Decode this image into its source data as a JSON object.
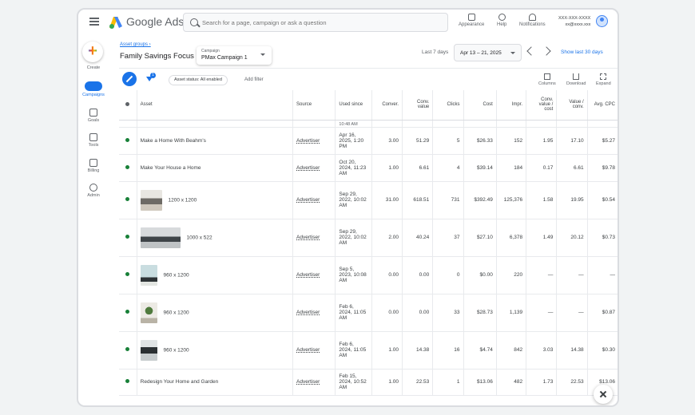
{
  "topbar": {
    "brand": "Google Ads",
    "search_placeholder": "Search for a page, campaign or ask a question",
    "appearance": "Appearance",
    "help": "Help",
    "notifications": "Notifications",
    "account_id": "XXX-XXX-XXXX",
    "account_email": "xx@xxxx.xxx"
  },
  "nav": {
    "create": "Create",
    "campaigns": "Campaigns",
    "goals": "Goals",
    "tools": "Tools",
    "billing": "Billing",
    "admin": "Admin"
  },
  "header": {
    "breadcrumb": "Asset groups ›",
    "title": "Family Savings Focus",
    "campaign_label": "Campaign",
    "campaign_value": "PMax Campaign 1",
    "date_label": "Last 7 days",
    "date_range": "Apr 13 – 21, 2025",
    "show_last": "Show last 30 days"
  },
  "toolbar": {
    "filter_count": "1",
    "status_chip": "Asset status: All enabled",
    "add_filter": "Add filter",
    "columns": "Columns",
    "download": "Download",
    "expand": "Expand"
  },
  "table": {
    "headers": {
      "asset": "Asset",
      "source": "Source",
      "used_since": "Used since",
      "conversions": "Conver.",
      "conv_value": "Conv. value",
      "clicks": "Clicks",
      "cost": "Cost",
      "impr": "Impr.",
      "conv_value_cost": "Conv. value / cost",
      "value_conv": "Value / conv.",
      "avg_cpc": "Avg. CPC"
    },
    "partial_row": "10:48 AM",
    "rows": [
      {
        "asset": "Make a Home With Beahm's",
        "source": "Advertiser",
        "used": "Apr 16, 2025, 1:20 PM",
        "conv": "3.00",
        "cval": "51.29",
        "clicks": "5",
        "cost": "$26.33",
        "impr": "152",
        "cvc": "1.95",
        "vpc": "17.10",
        "cpc": "$5.27"
      },
      {
        "asset": "Make Your House a Home",
        "source": "Advertiser",
        "used": "Oct 20, 2024, 11:23 AM",
        "conv": "1.00",
        "cval": "6.61",
        "clicks": "4",
        "cost": "$39.14",
        "impr": "184",
        "cvc": "0.17",
        "vpc": "6.61",
        "cpc": "$9.78"
      },
      {
        "asset": "1200 x 1200",
        "source": "Advertiser",
        "used": "Sep 29, 2022, 10:02 AM",
        "conv": "31.00",
        "cval": "618.51",
        "clicks": "731",
        "cost": "$392.49",
        "impr": "125,376",
        "cvc": "1.58",
        "vpc": "19.95",
        "cpc": "$0.54"
      },
      {
        "asset": "1000 x 522",
        "source": "Advertiser",
        "used": "Sep 29, 2022, 10:02 AM",
        "conv": "2.00",
        "cval": "40.24",
        "clicks": "37",
        "cost": "$27.10",
        "impr": "6,378",
        "cvc": "1.49",
        "vpc": "20.12",
        "cpc": "$0.73"
      },
      {
        "asset": "960 x 1200",
        "source": "Advertiser",
        "used": "Sep 5, 2023, 10:08 AM",
        "conv": "0.00",
        "cval": "0.00",
        "clicks": "0",
        "cost": "$0.00",
        "impr": "220",
        "cvc": "—",
        "vpc": "—",
        "cpc": "—"
      },
      {
        "asset": "960 x 1200",
        "source": "Advertiser",
        "used": "Feb 6, 2024, 11:05 AM",
        "conv": "0.00",
        "cval": "0.00",
        "clicks": "33",
        "cost": "$28.73",
        "impr": "1,139",
        "cvc": "—",
        "vpc": "—",
        "cpc": "$0.87"
      },
      {
        "asset": "960 x 1200",
        "source": "Advertiser",
        "used": "Feb 6, 2024, 11:05 AM",
        "conv": "1.00",
        "cval": "14.38",
        "clicks": "16",
        "cost": "$4.74",
        "impr": "842",
        "cvc": "3.03",
        "vpc": "14.38",
        "cpc": "$0.30"
      },
      {
        "asset": "Redesign Your Home and Garden",
        "source": "Advertiser",
        "used": "Feb 15, 2024, 10:52 AM",
        "conv": "1.00",
        "cval": "22.53",
        "clicks": "1",
        "cost": "$13.06",
        "impr": "482",
        "cvc": "1.73",
        "vpc": "22.53",
        "cpc": "$13.06"
      }
    ]
  },
  "colors": {
    "accent": "#1a73e8",
    "status_enabled": "#188038"
  }
}
